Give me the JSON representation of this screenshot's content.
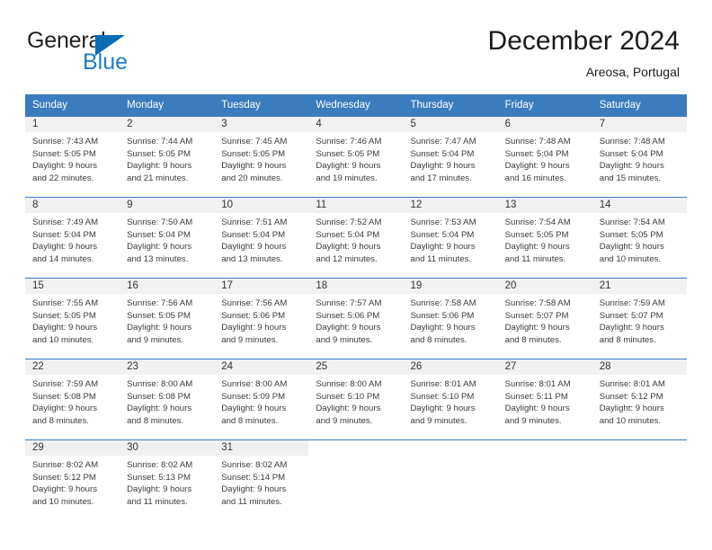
{
  "brand": {
    "name_part1": "General",
    "name_part2": "Blue",
    "flag_icon": "triangle-flag-icon"
  },
  "header": {
    "month_title": "December 2024",
    "location": "Areosa, Portugal"
  },
  "colors": {
    "header_blue": "#3a7cbe",
    "brand_blue": "#1c7fc4",
    "daynum_band": "#f1f1f1",
    "text": "#333333"
  },
  "calendar": {
    "weekdays": [
      "Sunday",
      "Monday",
      "Tuesday",
      "Wednesday",
      "Thursday",
      "Friday",
      "Saturday"
    ],
    "weeks": [
      [
        {
          "day": "1",
          "sunrise": "Sunrise: 7:43 AM",
          "sunset": "Sunset: 5:05 PM",
          "daylight1": "Daylight: 9 hours",
          "daylight2": "and 22 minutes."
        },
        {
          "day": "2",
          "sunrise": "Sunrise: 7:44 AM",
          "sunset": "Sunset: 5:05 PM",
          "daylight1": "Daylight: 9 hours",
          "daylight2": "and 21 minutes."
        },
        {
          "day": "3",
          "sunrise": "Sunrise: 7:45 AM",
          "sunset": "Sunset: 5:05 PM",
          "daylight1": "Daylight: 9 hours",
          "daylight2": "and 20 minutes."
        },
        {
          "day": "4",
          "sunrise": "Sunrise: 7:46 AM",
          "sunset": "Sunset: 5:05 PM",
          "daylight1": "Daylight: 9 hours",
          "daylight2": "and 19 minutes."
        },
        {
          "day": "5",
          "sunrise": "Sunrise: 7:47 AM",
          "sunset": "Sunset: 5:04 PM",
          "daylight1": "Daylight: 9 hours",
          "daylight2": "and 17 minutes."
        },
        {
          "day": "6",
          "sunrise": "Sunrise: 7:48 AM",
          "sunset": "Sunset: 5:04 PM",
          "daylight1": "Daylight: 9 hours",
          "daylight2": "and 16 minutes."
        },
        {
          "day": "7",
          "sunrise": "Sunrise: 7:48 AM",
          "sunset": "Sunset: 5:04 PM",
          "daylight1": "Daylight: 9 hours",
          "daylight2": "and 15 minutes."
        }
      ],
      [
        {
          "day": "8",
          "sunrise": "Sunrise: 7:49 AM",
          "sunset": "Sunset: 5:04 PM",
          "daylight1": "Daylight: 9 hours",
          "daylight2": "and 14 minutes."
        },
        {
          "day": "9",
          "sunrise": "Sunrise: 7:50 AM",
          "sunset": "Sunset: 5:04 PM",
          "daylight1": "Daylight: 9 hours",
          "daylight2": "and 13 minutes."
        },
        {
          "day": "10",
          "sunrise": "Sunrise: 7:51 AM",
          "sunset": "Sunset: 5:04 PM",
          "daylight1": "Daylight: 9 hours",
          "daylight2": "and 13 minutes."
        },
        {
          "day": "11",
          "sunrise": "Sunrise: 7:52 AM",
          "sunset": "Sunset: 5:04 PM",
          "daylight1": "Daylight: 9 hours",
          "daylight2": "and 12 minutes."
        },
        {
          "day": "12",
          "sunrise": "Sunrise: 7:53 AM",
          "sunset": "Sunset: 5:04 PM",
          "daylight1": "Daylight: 9 hours",
          "daylight2": "and 11 minutes."
        },
        {
          "day": "13",
          "sunrise": "Sunrise: 7:54 AM",
          "sunset": "Sunset: 5:05 PM",
          "daylight1": "Daylight: 9 hours",
          "daylight2": "and 11 minutes."
        },
        {
          "day": "14",
          "sunrise": "Sunrise: 7:54 AM",
          "sunset": "Sunset: 5:05 PM",
          "daylight1": "Daylight: 9 hours",
          "daylight2": "and 10 minutes."
        }
      ],
      [
        {
          "day": "15",
          "sunrise": "Sunrise: 7:55 AM",
          "sunset": "Sunset: 5:05 PM",
          "daylight1": "Daylight: 9 hours",
          "daylight2": "and 10 minutes."
        },
        {
          "day": "16",
          "sunrise": "Sunrise: 7:56 AM",
          "sunset": "Sunset: 5:05 PM",
          "daylight1": "Daylight: 9 hours",
          "daylight2": "and 9 minutes."
        },
        {
          "day": "17",
          "sunrise": "Sunrise: 7:56 AM",
          "sunset": "Sunset: 5:06 PM",
          "daylight1": "Daylight: 9 hours",
          "daylight2": "and 9 minutes."
        },
        {
          "day": "18",
          "sunrise": "Sunrise: 7:57 AM",
          "sunset": "Sunset: 5:06 PM",
          "daylight1": "Daylight: 9 hours",
          "daylight2": "and 9 minutes."
        },
        {
          "day": "19",
          "sunrise": "Sunrise: 7:58 AM",
          "sunset": "Sunset: 5:06 PM",
          "daylight1": "Daylight: 9 hours",
          "daylight2": "and 8 minutes."
        },
        {
          "day": "20",
          "sunrise": "Sunrise: 7:58 AM",
          "sunset": "Sunset: 5:07 PM",
          "daylight1": "Daylight: 9 hours",
          "daylight2": "and 8 minutes."
        },
        {
          "day": "21",
          "sunrise": "Sunrise: 7:59 AM",
          "sunset": "Sunset: 5:07 PM",
          "daylight1": "Daylight: 9 hours",
          "daylight2": "and 8 minutes."
        }
      ],
      [
        {
          "day": "22",
          "sunrise": "Sunrise: 7:59 AM",
          "sunset": "Sunset: 5:08 PM",
          "daylight1": "Daylight: 9 hours",
          "daylight2": "and 8 minutes."
        },
        {
          "day": "23",
          "sunrise": "Sunrise: 8:00 AM",
          "sunset": "Sunset: 5:08 PM",
          "daylight1": "Daylight: 9 hours",
          "daylight2": "and 8 minutes."
        },
        {
          "day": "24",
          "sunrise": "Sunrise: 8:00 AM",
          "sunset": "Sunset: 5:09 PM",
          "daylight1": "Daylight: 9 hours",
          "daylight2": "and 8 minutes."
        },
        {
          "day": "25",
          "sunrise": "Sunrise: 8:00 AM",
          "sunset": "Sunset: 5:10 PM",
          "daylight1": "Daylight: 9 hours",
          "daylight2": "and 9 minutes."
        },
        {
          "day": "26",
          "sunrise": "Sunrise: 8:01 AM",
          "sunset": "Sunset: 5:10 PM",
          "daylight1": "Daylight: 9 hours",
          "daylight2": "and 9 minutes."
        },
        {
          "day": "27",
          "sunrise": "Sunrise: 8:01 AM",
          "sunset": "Sunset: 5:11 PM",
          "daylight1": "Daylight: 9 hours",
          "daylight2": "and 9 minutes."
        },
        {
          "day": "28",
          "sunrise": "Sunrise: 8:01 AM",
          "sunset": "Sunset: 5:12 PM",
          "daylight1": "Daylight: 9 hours",
          "daylight2": "and 10 minutes."
        }
      ],
      [
        {
          "day": "29",
          "sunrise": "Sunrise: 8:02 AM",
          "sunset": "Sunset: 5:12 PM",
          "daylight1": "Daylight: 9 hours",
          "daylight2": "and 10 minutes."
        },
        {
          "day": "30",
          "sunrise": "Sunrise: 8:02 AM",
          "sunset": "Sunset: 5:13 PM",
          "daylight1": "Daylight: 9 hours",
          "daylight2": "and 11 minutes."
        },
        {
          "day": "31",
          "sunrise": "Sunrise: 8:02 AM",
          "sunset": "Sunset: 5:14 PM",
          "daylight1": "Daylight: 9 hours",
          "daylight2": "and 11 minutes."
        },
        {
          "day": "",
          "sunrise": "",
          "sunset": "",
          "daylight1": "",
          "daylight2": ""
        },
        {
          "day": "",
          "sunrise": "",
          "sunset": "",
          "daylight1": "",
          "daylight2": ""
        },
        {
          "day": "",
          "sunrise": "",
          "sunset": "",
          "daylight1": "",
          "daylight2": ""
        },
        {
          "day": "",
          "sunrise": "",
          "sunset": "",
          "daylight1": "",
          "daylight2": ""
        }
      ]
    ]
  }
}
